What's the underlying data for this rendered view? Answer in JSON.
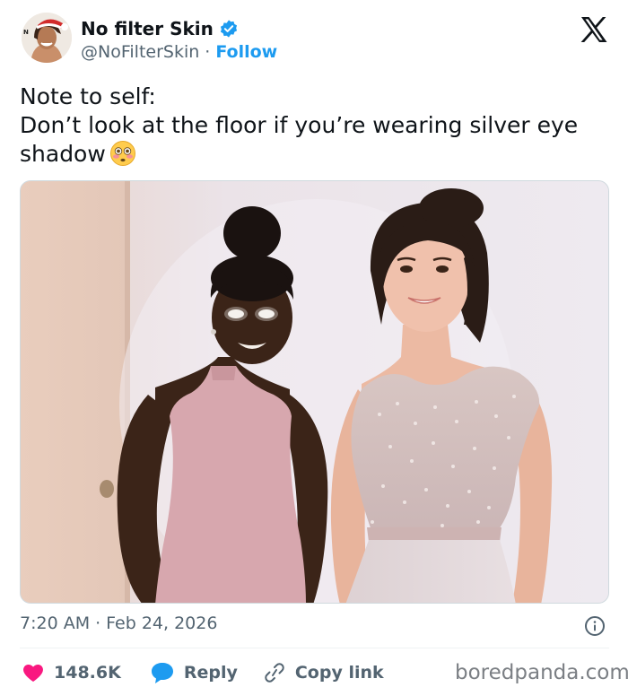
{
  "author": {
    "display_name": "No filter Skin",
    "handle": "@NoFilterSkin",
    "separator": "·",
    "follow_label": "Follow",
    "verified": true
  },
  "tweet": {
    "lines": [
      "Note to self:",
      "Don’t look at the floor if you’re wearing silver eye",
      "shadow"
    ],
    "emoji": "flushed-face"
  },
  "meta": {
    "time": "7:20 AM",
    "separator": "·",
    "date": "Feb 24, 2026"
  },
  "actions": {
    "likes": "148.6K",
    "reply_label": "Reply",
    "copy_link_label": "Copy link"
  },
  "watermark": "boredpanda.com",
  "colors": {
    "accent": "#1d9bf0",
    "like": "#f91880",
    "text": "#0f1419",
    "secondary": "#536471"
  },
  "icons": {
    "verified": "verified-badge-icon",
    "platform": "x-logo-icon",
    "info": "info-icon",
    "like": "heart-icon",
    "reply": "speech-bubble-icon",
    "copy_link": "link-icon"
  }
}
